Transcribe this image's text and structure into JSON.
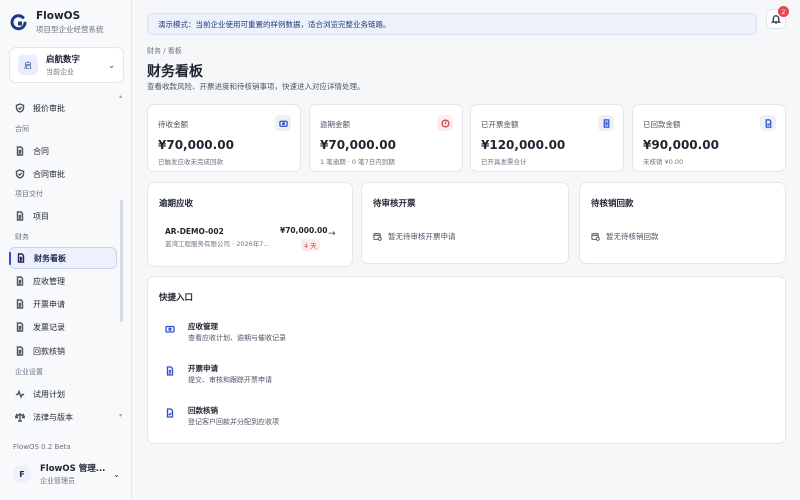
{
  "brand": {
    "name": "FlowOS",
    "subtitle": "项目型企业经营系统"
  },
  "org": {
    "avatar": "启",
    "name": "启航数字",
    "subtitle": "当前企业"
  },
  "sidebar": {
    "items": [
      {
        "label": "报价审批",
        "icon": "shield-check-icon"
      },
      {
        "label": "合同",
        "icon": "document-icon"
      },
      {
        "label": "合同审批",
        "icon": "shield-check-icon"
      },
      {
        "label": "项目",
        "icon": "document-icon"
      },
      {
        "label": "财务看板",
        "icon": "document-icon",
        "active": true
      },
      {
        "label": "应收管理",
        "icon": "document-icon"
      },
      {
        "label": "开票申请",
        "icon": "document-icon"
      },
      {
        "label": "发票记录",
        "icon": "document-icon"
      },
      {
        "label": "回款核销",
        "icon": "document-icon"
      },
      {
        "label": "试用计划",
        "icon": "activity-icon"
      },
      {
        "label": "法律与版本",
        "icon": "scale-icon"
      }
    ],
    "sections": [
      "合同",
      "项目交付",
      "财务",
      "企业设置"
    ],
    "version": "FlowOS 0.2 Beta"
  },
  "user": {
    "avatar": "F",
    "name": "FlowOS 管理...",
    "role": "企业管理员"
  },
  "banner": "演示模式：当前企业使用可重置的样例数据，适合浏览完整业务链路。",
  "notifications": {
    "count": "2"
  },
  "breadcrumb": "财务 / 看板",
  "page": {
    "title": "财务看板",
    "description": "查看收款风险、开票进度和待核销事项，快速进入对应详情处理。"
  },
  "stats": [
    {
      "label": "待收金额",
      "value": "¥70,000.00",
      "note": "已触发应收未完成回款",
      "icon": "wallet-icon",
      "color": "#2f4fd1"
    },
    {
      "label": "逾期金额",
      "value": "¥70,000.00",
      "note": "1 笔逾期 · 0 笔7日内到期",
      "icon": "alert-icon",
      "color": "#d23c3c"
    },
    {
      "label": "已开票金额",
      "value": "¥120,000.00",
      "note": "已开具发票合计",
      "icon": "document-icon",
      "color": "#2f4fd1"
    },
    {
      "label": "已回款金额",
      "value": "¥90,000.00",
      "note": "未核销 ¥0.00",
      "icon": "file-check-icon",
      "color": "#2f4fd1"
    }
  ],
  "overdue": {
    "title": "逾期应收",
    "item": {
      "id": "AR-DEMO-002",
      "sub": "蓝湾工程服务有限公司 · 2026年7月...",
      "amount": "¥70,000.00",
      "badge": "4 天"
    }
  },
  "pending_invoice": {
    "title": "待审核开票",
    "empty": "暂无待审核开票申请"
  },
  "pending_writeoff": {
    "title": "待核销回款",
    "empty": "暂无待核销回款"
  },
  "quick": {
    "title": "快捷入口",
    "items": [
      {
        "title": "应收管理",
        "desc": "查看应收计划、逾期与催收记录",
        "icon": "wallet-icon"
      },
      {
        "title": "开票申请",
        "desc": "提交、审核和跟踪开票申请",
        "icon": "document-icon"
      },
      {
        "title": "回款核销",
        "desc": "登记客户回款并分配到应收项",
        "icon": "file-check-icon"
      }
    ]
  }
}
